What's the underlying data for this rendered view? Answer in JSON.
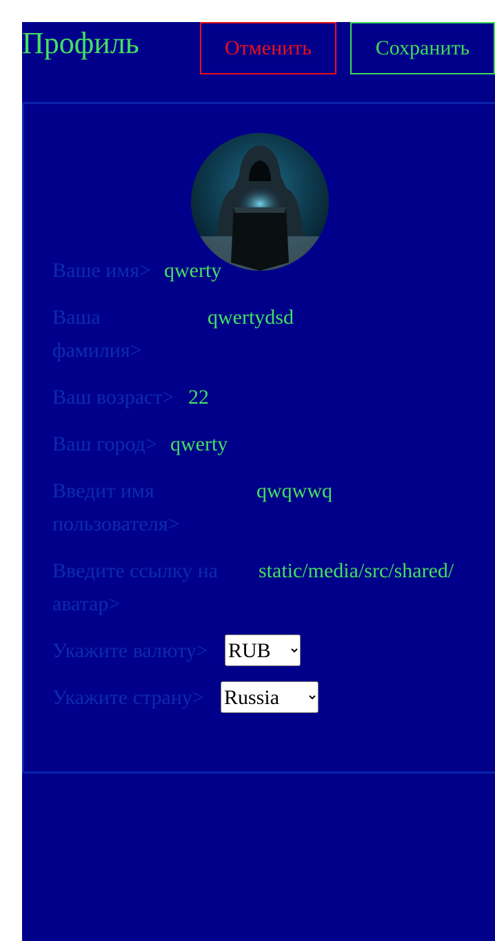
{
  "header": {
    "title": "Профиль",
    "cancel_label": "Отменить",
    "save_label": "Сохранить"
  },
  "colors": {
    "background": "#00008b",
    "accent_green": "#44e060",
    "cancel_red": "#e8101a",
    "label_blue": "#0c2bb0"
  },
  "profile": {
    "avatar_icon": "hooded-hacker-avatar",
    "fields": [
      {
        "label": "Ваше имя>",
        "value": "qwerty"
      },
      {
        "label_line1": "Ваша",
        "label_line2": "фамилия>",
        "value": "qwertydsd"
      },
      {
        "label": "Ваш возраст>",
        "value": "22"
      },
      {
        "label": "Ваш город>",
        "value": "qwerty"
      },
      {
        "label_line1": "Введит имя",
        "label_line2": "пользователя>",
        "value": "qwqwwq"
      },
      {
        "label_line1": "Введите ссылку на",
        "label_line2": "аватар>",
        "value": "static/media/src/shared/"
      }
    ],
    "currency": {
      "label": "Укажите валюту>",
      "selected": "RUB"
    },
    "country": {
      "label": "Укажите страну>",
      "selected": "Russia"
    }
  }
}
